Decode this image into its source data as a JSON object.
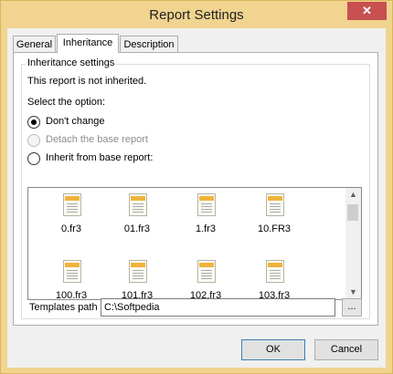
{
  "window": {
    "title": "Report Settings",
    "close_glyph": "✕"
  },
  "tabs": [
    {
      "label": "General",
      "active": false
    },
    {
      "label": "Inheritance",
      "active": true
    },
    {
      "label": "Description",
      "active": false
    }
  ],
  "inheritance": {
    "group_title": "Inheritance settings",
    "status_text": "This report is not inherited.",
    "select_label": "Select the option:",
    "options": [
      {
        "label": "Don't change",
        "checked": true,
        "disabled": false
      },
      {
        "label": "Detach the base report",
        "checked": false,
        "disabled": true
      },
      {
        "label": "Inherit from base report:",
        "checked": false,
        "disabled": false
      }
    ],
    "templates": [
      {
        "name": "0.fr3",
        "icon": "report-file-icon"
      },
      {
        "name": "01.fr3",
        "icon": "report-file-icon"
      },
      {
        "name": "1.fr3",
        "icon": "report-file-icon"
      },
      {
        "name": "10.FR3",
        "icon": "report-file-icon"
      },
      {
        "name": "100.fr3",
        "icon": "report-file-icon"
      },
      {
        "name": "101.fr3",
        "icon": "report-file-icon"
      },
      {
        "name": "102.fr3",
        "icon": "report-file-icon"
      },
      {
        "name": "103.fr3",
        "icon": "report-file-icon"
      }
    ],
    "templates_path_label": "Templates path :",
    "templates_path_value": "C:\\Softpedia",
    "browse_label": "..."
  },
  "buttons": {
    "ok": "OK",
    "cancel": "Cancel"
  },
  "colors": {
    "title_bar": "#f0d48f",
    "close_button": "#c75050",
    "file_icon_band": "#f0b33b"
  }
}
